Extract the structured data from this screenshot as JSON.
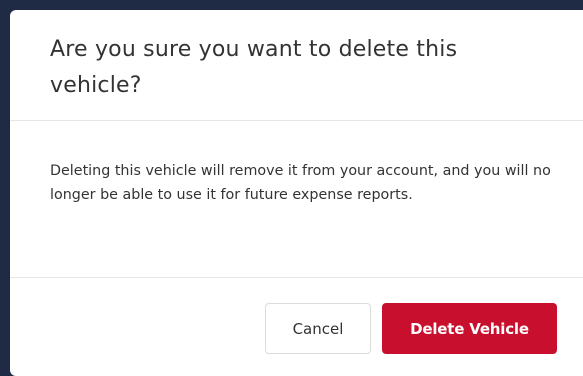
{
  "dialog": {
    "title": "Are you sure you want to delete this vehicle?",
    "message": "Deleting this vehicle will remove it from your account, and you will no longer be able to use it for future expense reports.",
    "cancel_label": "Cancel",
    "confirm_label": "Delete Vehicle"
  },
  "colors": {
    "backdrop": "#1f2a44",
    "confirm_button": "#c8102e",
    "text": "#333333"
  }
}
